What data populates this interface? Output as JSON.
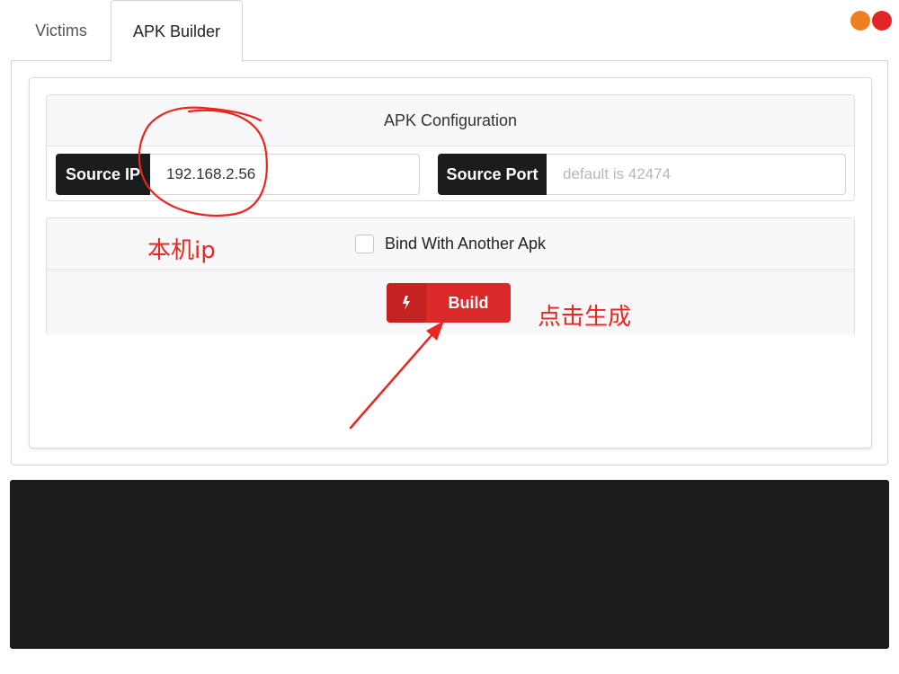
{
  "tabs": {
    "victims": "Victims",
    "apk_builder": "APK Builder"
  },
  "colors": {
    "dot_orange": "#f07f24",
    "dot_red": "#e02626",
    "build_red": "#db2828",
    "annotation_red": "#e8281f",
    "console_bg": "#1b1c1d"
  },
  "config": {
    "header": "APK Configuration",
    "source_ip": {
      "label": "Source IP",
      "value": "192.168.2.56"
    },
    "source_port": {
      "label": "Source Port",
      "placeholder": "default is 42474"
    }
  },
  "options": {
    "bind_label": "Bind With Another Apk",
    "bind_checked": false
  },
  "build": {
    "label": "Build",
    "icon": "lightning-icon"
  },
  "annotations": {
    "ip_note": "本机ip",
    "build_note": "点击生成"
  }
}
